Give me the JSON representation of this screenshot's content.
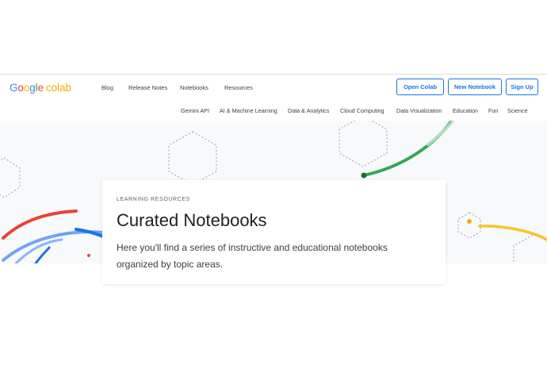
{
  "header": {
    "logo": {
      "google": [
        "G",
        "o",
        "o",
        "g",
        "l",
        "e"
      ],
      "product": "colab"
    },
    "nav": [
      "Blog",
      "Release Notes",
      "Notebooks",
      "Resources"
    ],
    "buttons": {
      "open": "Open Colab",
      "new": "New Notebook",
      "signup": "Sign Up"
    }
  },
  "subnav": [
    "Gemini API",
    "AI & Machine Learning",
    "Data & Analytics",
    "Cloud Computing",
    "Data Visualization",
    "Education",
    "Fun",
    "Science"
  ],
  "hero": {
    "eyebrow": "LEARNING RESOURCES",
    "title": "Curated Notebooks",
    "description": "Here you'll find a series of instructive and educational notebooks organized by topic areas."
  },
  "colors": {
    "accent": "#1a73e8",
    "arc_red": "#ea4335",
    "arc_blue": "#4285f4",
    "arc_green": "#34a853",
    "arc_yellow": "#fbbc04"
  }
}
